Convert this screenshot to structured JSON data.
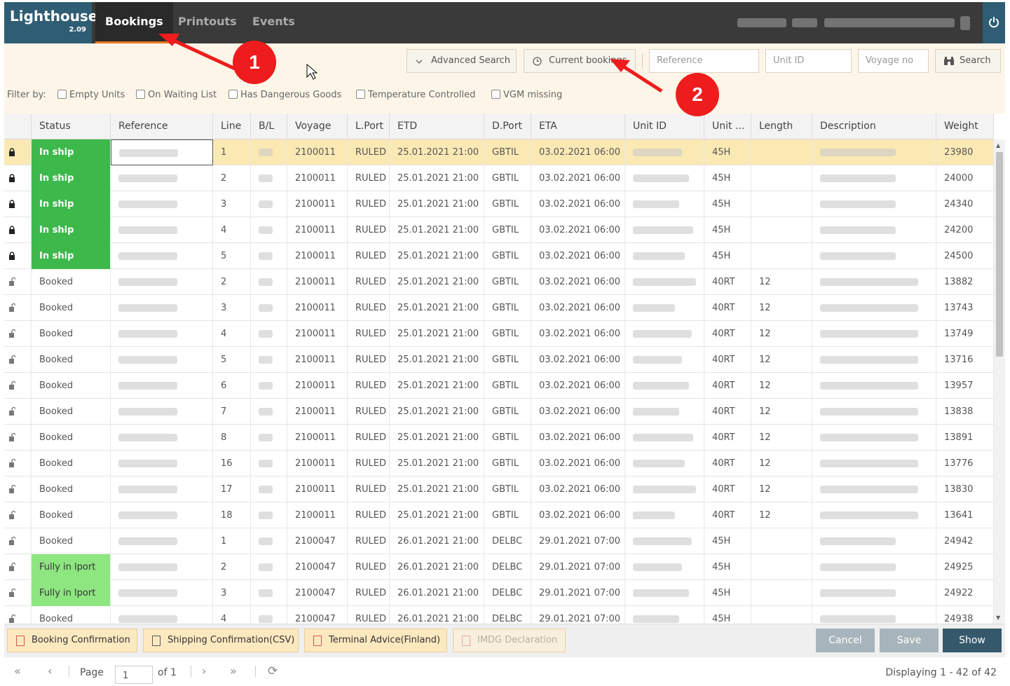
{
  "app": {
    "name": "Lighthouse",
    "version": "2.09"
  },
  "nav": {
    "tabs": [
      "Bookings",
      "Printouts",
      "Events"
    ],
    "active": "Bookings"
  },
  "toolbar": {
    "advanced_search": "Advanced Search",
    "current_bookings": "Current bookings",
    "reference_placeholder": "Reference",
    "unitid_placeholder": "Unit ID",
    "voyage_placeholder": "Voyage no",
    "search": "Search"
  },
  "filters": {
    "label": "Filter by:",
    "items": [
      "Empty Units",
      "On Waiting List",
      "Has Dangerous Goods",
      "Temperature Controlled",
      "VGM missing"
    ]
  },
  "grid": {
    "columns": [
      "Status",
      "Reference",
      "Line",
      "B/L",
      "Voyage",
      "L.Port",
      "ETD",
      "D.Port",
      "ETA",
      "Unit ID",
      "Unit ...",
      "Length",
      "Description",
      "Weight"
    ],
    "rows": [
      {
        "locked": true,
        "status": "In ship",
        "line": "1",
        "voyage": "2100011",
        "lport": "RULED",
        "etd": "25.01.2021 21:00",
        "dport": "GBTIL",
        "eta": "03.02.2021 06:00",
        "unit_type": "45H",
        "length": "",
        "weight": "23980"
      },
      {
        "locked": true,
        "status": "In ship",
        "line": "2",
        "voyage": "2100011",
        "lport": "RULED",
        "etd": "25.01.2021 21:00",
        "dport": "GBTIL",
        "eta": "03.02.2021 06:00",
        "unit_type": "45H",
        "length": "",
        "weight": "24000"
      },
      {
        "locked": true,
        "status": "In ship",
        "line": "3",
        "voyage": "2100011",
        "lport": "RULED",
        "etd": "25.01.2021 21:00",
        "dport": "GBTIL",
        "eta": "03.02.2021 06:00",
        "unit_type": "45H",
        "length": "",
        "weight": "24340"
      },
      {
        "locked": true,
        "status": "In ship",
        "line": "4",
        "voyage": "2100011",
        "lport": "RULED",
        "etd": "25.01.2021 21:00",
        "dport": "GBTIL",
        "eta": "03.02.2021 06:00",
        "unit_type": "45H",
        "length": "",
        "weight": "24200"
      },
      {
        "locked": true,
        "status": "In ship",
        "line": "5",
        "voyage": "2100011",
        "lport": "RULED",
        "etd": "25.01.2021 21:00",
        "dport": "GBTIL",
        "eta": "03.02.2021 06:00",
        "unit_type": "45H",
        "length": "",
        "weight": "24500"
      },
      {
        "locked": false,
        "status": "Booked",
        "line": "2",
        "voyage": "2100011",
        "lport": "RULED",
        "etd": "25.01.2021 21:00",
        "dport": "GBTIL",
        "eta": "03.02.2021 06:00",
        "unit_type": "40RT",
        "length": "12",
        "weight": "13882"
      },
      {
        "locked": false,
        "status": "Booked",
        "line": "3",
        "voyage": "2100011",
        "lport": "RULED",
        "etd": "25.01.2021 21:00",
        "dport": "GBTIL",
        "eta": "03.02.2021 06:00",
        "unit_type": "40RT",
        "length": "12",
        "weight": "13743"
      },
      {
        "locked": false,
        "status": "Booked",
        "line": "4",
        "voyage": "2100011",
        "lport": "RULED",
        "etd": "25.01.2021 21:00",
        "dport": "GBTIL",
        "eta": "03.02.2021 06:00",
        "unit_type": "40RT",
        "length": "12",
        "weight": "13749"
      },
      {
        "locked": false,
        "status": "Booked",
        "line": "5",
        "voyage": "2100011",
        "lport": "RULED",
        "etd": "25.01.2021 21:00",
        "dport": "GBTIL",
        "eta": "03.02.2021 06:00",
        "unit_type": "40RT",
        "length": "12",
        "weight": "13716"
      },
      {
        "locked": false,
        "status": "Booked",
        "line": "6",
        "voyage": "2100011",
        "lport": "RULED",
        "etd": "25.01.2021 21:00",
        "dport": "GBTIL",
        "eta": "03.02.2021 06:00",
        "unit_type": "40RT",
        "length": "12",
        "weight": "13957"
      },
      {
        "locked": false,
        "status": "Booked",
        "line": "7",
        "voyage": "2100011",
        "lport": "RULED",
        "etd": "25.01.2021 21:00",
        "dport": "GBTIL",
        "eta": "03.02.2021 06:00",
        "unit_type": "40RT",
        "length": "12",
        "weight": "13838"
      },
      {
        "locked": false,
        "status": "Booked",
        "line": "8",
        "voyage": "2100011",
        "lport": "RULED",
        "etd": "25.01.2021 21:00",
        "dport": "GBTIL",
        "eta": "03.02.2021 06:00",
        "unit_type": "40RT",
        "length": "12",
        "weight": "13891"
      },
      {
        "locked": false,
        "status": "Booked",
        "line": "16",
        "voyage": "2100011",
        "lport": "RULED",
        "etd": "25.01.2021 21:00",
        "dport": "GBTIL",
        "eta": "03.02.2021 06:00",
        "unit_type": "40RT",
        "length": "12",
        "weight": "13776"
      },
      {
        "locked": false,
        "status": "Booked",
        "line": "17",
        "voyage": "2100011",
        "lport": "RULED",
        "etd": "25.01.2021 21:00",
        "dport": "GBTIL",
        "eta": "03.02.2021 06:00",
        "unit_type": "40RT",
        "length": "12",
        "weight": "13830"
      },
      {
        "locked": false,
        "status": "Booked",
        "line": "18",
        "voyage": "2100011",
        "lport": "RULED",
        "etd": "25.01.2021 21:00",
        "dport": "GBTIL",
        "eta": "03.02.2021 06:00",
        "unit_type": "40RT",
        "length": "12",
        "weight": "13641"
      },
      {
        "locked": false,
        "status": "Booked",
        "line": "1",
        "voyage": "2100047",
        "lport": "RULED",
        "etd": "26.01.2021 21:00",
        "dport": "DELBC",
        "eta": "29.01.2021 07:00",
        "unit_type": "45H",
        "length": "",
        "weight": "24942"
      },
      {
        "locked": false,
        "status": "Fully in lport",
        "line": "2",
        "voyage": "2100047",
        "lport": "RULED",
        "etd": "26.01.2021 21:00",
        "dport": "DELBC",
        "eta": "29.01.2021 07:00",
        "unit_type": "45H",
        "length": "",
        "weight": "24925"
      },
      {
        "locked": false,
        "status": "Fully in lport",
        "line": "3",
        "voyage": "2100047",
        "lport": "RULED",
        "etd": "26.01.2021 21:00",
        "dport": "DELBC",
        "eta": "29.01.2021 07:00",
        "unit_type": "45H",
        "length": "",
        "weight": "24922"
      },
      {
        "locked": false,
        "status": "Booked",
        "line": "4",
        "voyage": "2100047",
        "lport": "RULED",
        "etd": "26.01.2021 21:00",
        "dport": "DELBC",
        "eta": "29.01.2021 07:00",
        "unit_type": "45H",
        "length": "",
        "weight": "24938"
      }
    ]
  },
  "actions": {
    "booking_confirmation": "Booking Confirmation",
    "shipping_confirmation": "Shipping Confirmation(CSV)",
    "terminal_advice": "Terminal Advice(Finland)",
    "imdg_declaration": "IMDG Declaration",
    "cancel": "Cancel",
    "save": "Save",
    "show": "Show"
  },
  "pager": {
    "page_label": "Page",
    "page_value": "1",
    "of_label": "of 1",
    "display_text": "Displaying 1 - 42 of 42"
  },
  "annotations": {
    "badge1": "1",
    "badge2": "2"
  },
  "colors": {
    "in_ship": "#3db84b",
    "fully_in_lport": "#8de680",
    "selected_row": "#fbe9b4",
    "logo_bg": "#2f5d73",
    "annotation": "#ee1c1c",
    "active_tab_underline": "#e8791c"
  }
}
